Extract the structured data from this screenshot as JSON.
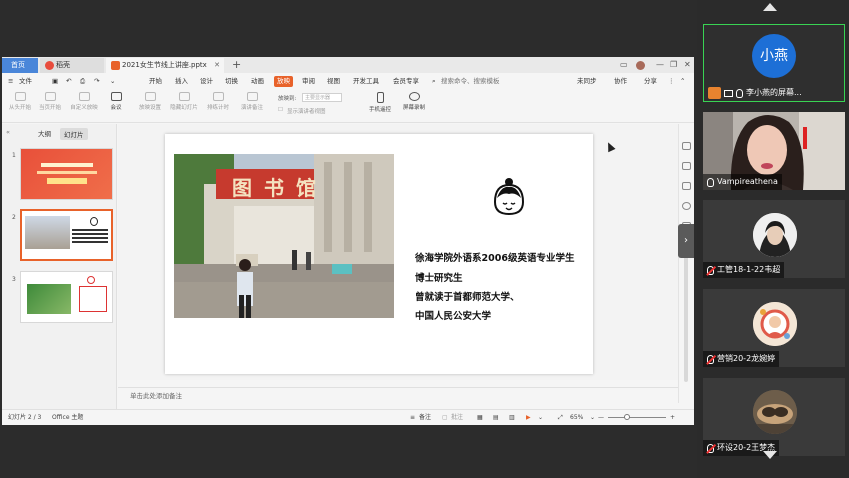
{
  "wps": {
    "tabs": {
      "home": "首页",
      "dao": "稻壳",
      "doc": "2021女生节线上讲座.pptx"
    },
    "menu": {
      "file": "文件",
      "items": [
        "开始",
        "插入",
        "设计",
        "切换",
        "动画",
        "放映",
        "审阅",
        "视图",
        "开发工具",
        "会员专享"
      ],
      "active_index": 5,
      "search": "搜索命令、搜索模板",
      "not_synced": "未同步",
      "collab": "协作",
      "share": "分享"
    },
    "ribbon": {
      "buttons": [
        "从头开始",
        "当页开始",
        "自定义放映",
        "会议",
        "放映设置",
        "隐藏幻灯片",
        "排练计时",
        "演讲备注"
      ],
      "show_on_label": "放映到:",
      "show_on_value": "主要显示器",
      "presenter_view": "显示演讲者视图",
      "remote": "手机遥控",
      "record": "屏幕录制"
    },
    "left_pane": {
      "tab_outline": "大纲",
      "tab_slides": "幻灯片",
      "slide_numbers": [
        "1",
        "2",
        "3"
      ]
    },
    "slide": {
      "lines": [
        "徐海学院外语系2006级英语专业学生",
        "博士研究生",
        "曾就读于首都师范大学、",
        "中国人民公安大学"
      ],
      "sign_chars": "图书馆"
    },
    "notes_placeholder": "单击此处添加备注",
    "status": {
      "slide_pos": "幻灯片 2 / 3",
      "theme": "Office 主题",
      "notes": "备注",
      "comments": "批注",
      "zoom": "65%"
    }
  },
  "meeting": {
    "participants": [
      {
        "name": "小燕",
        "label": "李小燕的屏幕...",
        "type": "initials",
        "color": "#1d6fd6",
        "sharing": true
      },
      {
        "name": "Vampireathena",
        "type": "video",
        "muted": false
      },
      {
        "name": "工管18-1-22韦超",
        "type": "photo",
        "muted": true
      },
      {
        "name": "营销20-2龙婉婷",
        "type": "photo",
        "muted": true
      },
      {
        "name": "环设20-2王梦杰",
        "type": "photo",
        "muted": true
      }
    ]
  },
  "colors": {
    "accent": "#e8622a",
    "wps_blue": "#4a86d9",
    "speaking": "#39d353"
  }
}
